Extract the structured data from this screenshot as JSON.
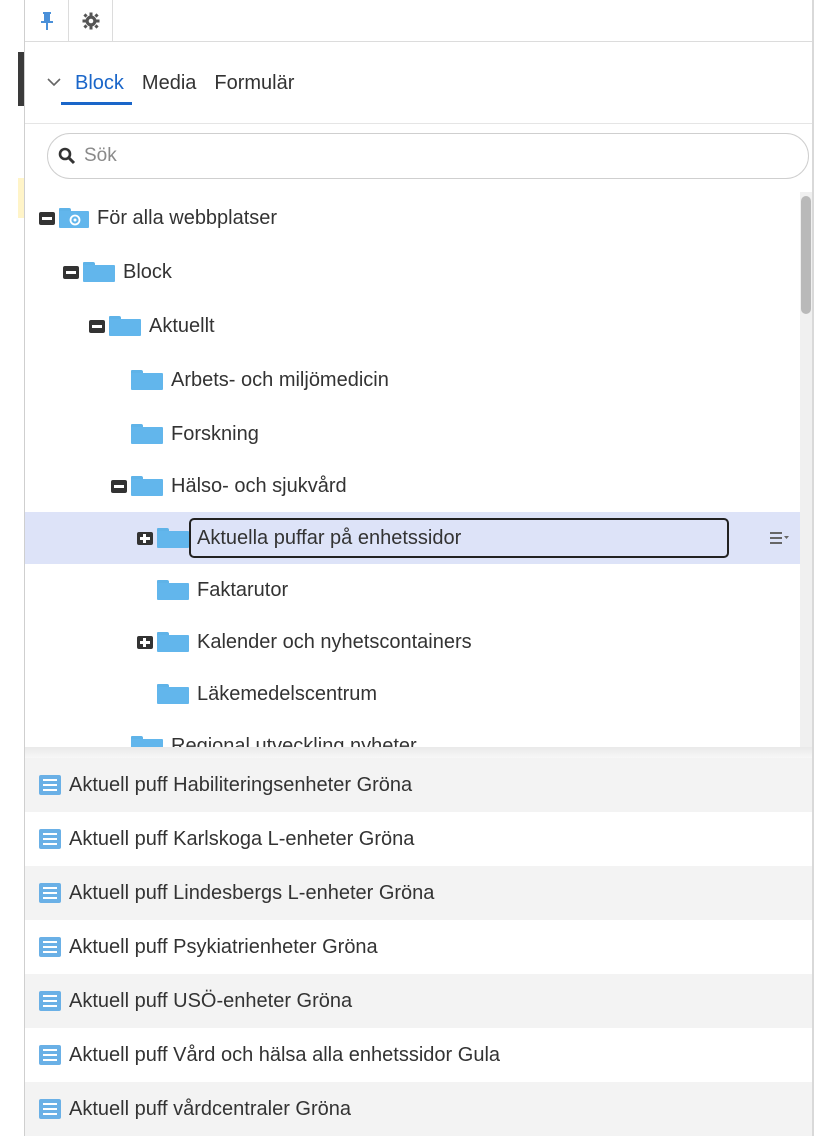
{
  "toolbar": {
    "pin_icon": "pin-icon",
    "settings_icon": "gear-icon"
  },
  "tabs": [
    {
      "label": "Block",
      "active": true
    },
    {
      "label": "Media",
      "active": false
    },
    {
      "label": "Formulär",
      "active": false
    }
  ],
  "search": {
    "placeholder": "Sök",
    "value": ""
  },
  "tree": {
    "items": [
      {
        "label": "För alla webbplatser",
        "level": 0,
        "toggle": "minus",
        "icon": "site-folder-icon"
      },
      {
        "label": "Block",
        "level": 1,
        "toggle": "minus",
        "icon": "folder-icon"
      },
      {
        "label": "Aktuellt",
        "level": 2,
        "toggle": "minus",
        "icon": "folder-icon"
      },
      {
        "label": "Arbets- och miljömedicin",
        "level": 3,
        "toggle": "none",
        "icon": "folder-icon"
      },
      {
        "label": "Forskning",
        "level": 3,
        "toggle": "none",
        "icon": "folder-icon"
      },
      {
        "label": "Hälso- och sjukvård",
        "level": 3,
        "toggle": "minus",
        "icon": "folder-icon"
      },
      {
        "label": "Aktuella puffar på enhetssidor",
        "level": 4,
        "toggle": "plus",
        "icon": "folder-icon",
        "selected": true,
        "editing": true
      },
      {
        "label": "Faktarutor",
        "level": 4,
        "toggle": "none",
        "icon": "folder-icon"
      },
      {
        "label": "Kalender och nyhetscontainers",
        "level": 4,
        "toggle": "plus",
        "icon": "folder-icon"
      },
      {
        "label": "Läkemedelscentrum",
        "level": 4,
        "toggle": "none",
        "icon": "folder-icon"
      },
      {
        "label": "Regional utveckling nyheter",
        "level": 3,
        "toggle": "none",
        "icon": "folder-icon"
      }
    ]
  },
  "list": {
    "items": [
      {
        "label": "Aktuell puff Habiliteringsenheter Gröna"
      },
      {
        "label": "Aktuell puff Karlskoga L-enheter Gröna"
      },
      {
        "label": "Aktuell puff Lindesbergs L-enheter Gröna"
      },
      {
        "label": "Aktuell puff Psykiatrienheter Gröna"
      },
      {
        "label": "Aktuell puff USÖ-enheter Gröna"
      },
      {
        "label": "Aktuell puff Vård och hälsa alla enhetssidor Gula"
      },
      {
        "label": "Aktuell puff vårdcentraler Gröna"
      }
    ]
  },
  "colors": {
    "accent": "#1a66c9",
    "folder": "#62b6ec",
    "selected_row": "#dde3f8"
  }
}
